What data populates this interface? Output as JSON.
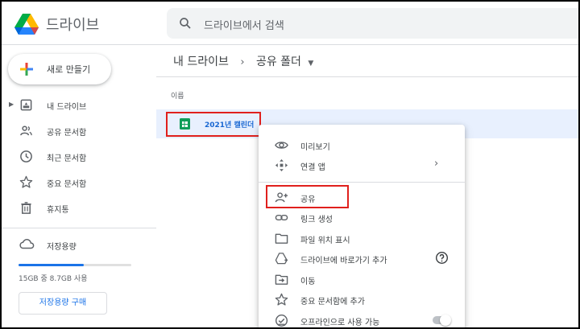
{
  "app": {
    "name": "드라이브"
  },
  "search": {
    "placeholder": "드라이브에서 검색"
  },
  "sidebar": {
    "new_button": "새로 만들기",
    "items": [
      {
        "label": "내 드라이브",
        "icon": "drive-folder-icon",
        "expandable": true
      },
      {
        "label": "공유 문서함",
        "icon": "people-icon"
      },
      {
        "label": "최근 문서함",
        "icon": "clock-icon"
      },
      {
        "label": "중요 문서함",
        "icon": "star-icon"
      },
      {
        "label": "휴지통",
        "icon": "trash-icon"
      }
    ],
    "storage": {
      "label": "저장용량",
      "icon": "cloud-icon",
      "usage_text": "15GB 중 8.7GB 사용",
      "used_fraction": 0.58,
      "buy_button": "저장용량 구매"
    }
  },
  "main": {
    "breadcrumb": {
      "root": "내 드라이브",
      "current": "공유 폴더"
    },
    "column_header": "이름",
    "files": [
      {
        "name": "2021년 캘린더",
        "icon": "google-sheets-icon",
        "selected": true
      }
    ]
  },
  "context_menu": {
    "items": [
      {
        "label": "미리보기",
        "icon": "eye-icon"
      },
      {
        "label": "연결 앱",
        "icon": "move-arrows-icon",
        "has_submenu": true
      },
      {
        "label": "공유",
        "icon": "person-add-icon",
        "highlighted": true
      },
      {
        "label": "링크 생성",
        "icon": "link-icon"
      },
      {
        "label": "파일 위치 표시",
        "icon": "folder-icon"
      },
      {
        "label": "드라이브에 바로가기 추가",
        "icon": "add-shortcut-icon",
        "has_help": true
      },
      {
        "label": "이동",
        "icon": "move-to-folder-icon"
      },
      {
        "label": "중요 문서함에 추가",
        "icon": "star-icon"
      },
      {
        "label": "오프라인으로 사용 가능",
        "icon": "offline-check-icon",
        "toggle": false
      }
    ]
  },
  "colors": {
    "accent": "#1a73e8",
    "highlight_box": "#e0201d",
    "selected_row": "#e8f0fe"
  }
}
